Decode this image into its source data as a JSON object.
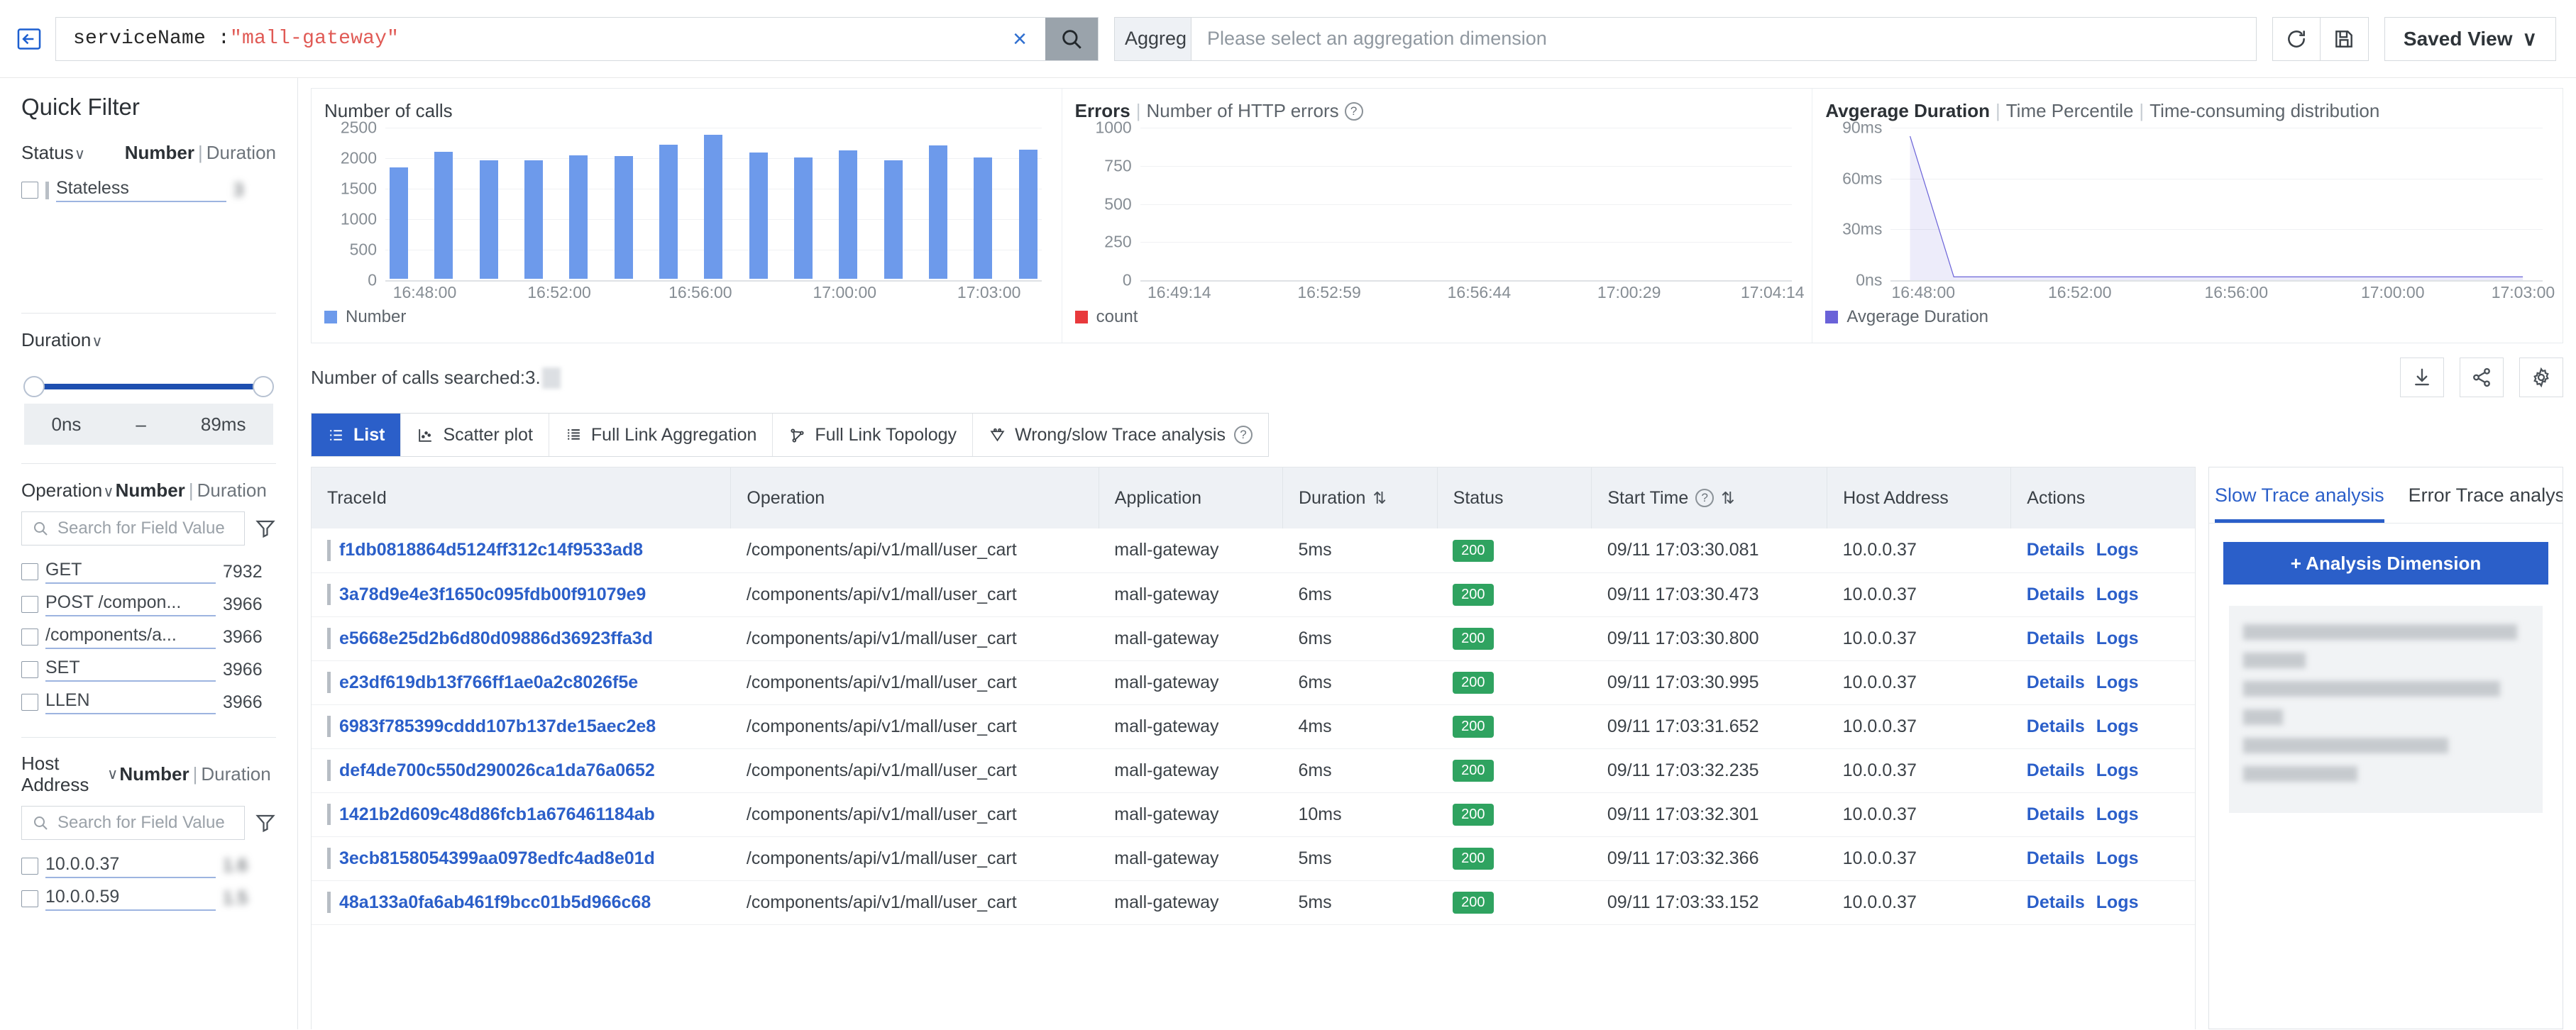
{
  "topbar": {
    "collapse_icon": "collapse-panel-icon",
    "search_key": "serviceName : ",
    "search_value": "\"mall-gateway\"",
    "clear_label": "×",
    "search_icon": "search-icon",
    "agg_label": "Aggreg",
    "agg_placeholder": "Please select an aggregation dimension",
    "refresh_icon": "refresh-icon",
    "save_icon": "save-disk-icon",
    "saved_view_label": "Saved View",
    "saved_view_caret": "∨"
  },
  "sidebar": {
    "title": "Quick Filter",
    "facets": [
      {
        "name": "Status",
        "caret": "∨",
        "metric_number": "Number",
        "metric_sep": "|",
        "metric_duration": "Duration",
        "rows": [
          {
            "label": "Stateless",
            "count": "3",
            "blurred": true
          }
        ]
      },
      {
        "name": "Duration",
        "caret": "∨",
        "slider": {
          "min_label": "0ns",
          "dash": "–",
          "max_label": "89ms"
        }
      },
      {
        "name": "Operation",
        "caret": "∨",
        "metric_number": "Number",
        "metric_sep": "|",
        "metric_duration": "Duration",
        "search_placeholder": "Search for Field Value",
        "rows": [
          {
            "label": "GET",
            "count": "7932"
          },
          {
            "label": "POST /compon...",
            "count": "3966"
          },
          {
            "label": "/components/a...",
            "count": "3966"
          },
          {
            "label": "SET",
            "count": "3966"
          },
          {
            "label": "LLEN",
            "count": "3966"
          }
        ]
      },
      {
        "name": "Host Address",
        "caret": "∨",
        "metric_number": "Number",
        "metric_sep": "|",
        "metric_duration": "Duration",
        "search_placeholder": "Search for Field Value",
        "rows": [
          {
            "label": "10.0.0.37",
            "count": "1.6",
            "blurred": true
          },
          {
            "label": "10.0.0.59",
            "count": "1.5",
            "blurred": true
          }
        ]
      }
    ]
  },
  "chart_data": [
    {
      "type": "bar",
      "title": "Number of calls",
      "xlabel": "",
      "ylabel": "",
      "ylim": [
        0,
        2500
      ],
      "yticks": [
        0,
        500,
        1000,
        1500,
        2000,
        2500
      ],
      "xticks": [
        "16:48:00",
        "16:52:00",
        "16:56:00",
        "17:00:00",
        "17:03:00"
      ],
      "categories": [
        "16:48",
        "16:49",
        "16:50",
        "16:51",
        "16:52",
        "16:53",
        "16:54",
        "16:55",
        "16:56",
        "16:57",
        "16:58",
        "16:59",
        "17:00",
        "17:01",
        "17:02"
      ],
      "values": [
        1840,
        2100,
        1960,
        1960,
        2040,
        2035,
        2215,
        2385,
        2085,
        2010,
        2120,
        1965,
        2210,
        2005,
        2135
      ],
      "legend": [
        "Number"
      ],
      "color": "#6d9aeb",
      "grid": true
    },
    {
      "type": "line",
      "title": "Errors",
      "title_sub": "Number of HTTP errors",
      "ylim": [
        0,
        1000
      ],
      "yticks": [
        0,
        250,
        500,
        750,
        1000
      ],
      "xticks": [
        "16:49:14",
        "16:52:59",
        "16:56:44",
        "17:00:29",
        "17:04:14"
      ],
      "values": [
        0,
        0,
        0,
        0,
        0,
        0,
        0,
        0,
        0,
        0,
        0,
        0,
        0,
        0,
        0
      ],
      "legend": [
        "count"
      ],
      "color": "#e8393c",
      "grid": true
    },
    {
      "type": "area",
      "title": "Avgerage Duration",
      "title_sub2": "Time Percentile",
      "title_sub3": "Time-consuming distribution",
      "ylim": [
        0,
        90
      ],
      "yticks": [
        "0ns",
        "30ms",
        "60ms",
        "90ms"
      ],
      "xticks": [
        "16:48:00",
        "16:52:00",
        "16:56:00",
        "17:00:00",
        "17:03:00"
      ],
      "values": [
        85,
        2,
        2,
        2,
        2,
        2,
        2,
        2,
        2,
        2,
        2,
        2,
        2,
        2,
        2
      ],
      "legend": [
        "Avgerage Duration"
      ],
      "color": "#6a62d8",
      "grid": true
    }
  ],
  "subtoolbar": {
    "searched_label": "Number of calls searched:3.",
    "download_icon": "download-icon",
    "share_icon": "share-icon",
    "settings_icon": "gear-icon"
  },
  "tabs": [
    {
      "label": "List",
      "icon": "list-icon",
      "active": true
    },
    {
      "label": "Scatter plot",
      "icon": "scatter-plot-icon",
      "active": false
    },
    {
      "label": "Full Link Aggregation",
      "icon": "aggregation-icon",
      "active": false
    },
    {
      "label": "Full Link Topology",
      "icon": "topology-icon",
      "active": false
    },
    {
      "label": "Wrong/slow Trace analysis",
      "icon": "trace-analysis-icon",
      "active": false,
      "help": "?"
    }
  ],
  "table": {
    "columns": [
      {
        "label": "TraceId",
        "sort": false,
        "help": false
      },
      {
        "label": "Operation",
        "sort": false,
        "help": false
      },
      {
        "label": "Application",
        "sort": false,
        "help": false
      },
      {
        "label": "Duration",
        "sort": true,
        "help": false
      },
      {
        "label": "Status",
        "sort": false,
        "help": false
      },
      {
        "label": "Start Time",
        "sort": true,
        "help": true
      },
      {
        "label": "Host Address",
        "sort": false,
        "help": false
      },
      {
        "label": "Actions",
        "sort": false,
        "help": false
      }
    ],
    "sort_glyph": "⇅",
    "action_details": "Details",
    "action_logs": "Logs",
    "rows": [
      {
        "trace": "f1db0818864d5124ff312c14f9533ad8",
        "operation": "/components/api/v1/mall/user_cart",
        "application": "mall-gateway",
        "duration": "5ms",
        "status": "200",
        "start": "09/11 17:03:30.081",
        "host": "10.0.0.37"
      },
      {
        "trace": "3a78d9e4e3f1650c095fdb00f91079e9",
        "operation": "/components/api/v1/mall/user_cart",
        "application": "mall-gateway",
        "duration": "6ms",
        "status": "200",
        "start": "09/11 17:03:30.473",
        "host": "10.0.0.37"
      },
      {
        "trace": "e5668e25d2b6d80d09886d36923ffa3d",
        "operation": "/components/api/v1/mall/user_cart",
        "application": "mall-gateway",
        "duration": "6ms",
        "status": "200",
        "start": "09/11 17:03:30.800",
        "host": "10.0.0.37"
      },
      {
        "trace": "e23df619db13f766ff1ae0a2c8026f5e",
        "operation": "/components/api/v1/mall/user_cart",
        "application": "mall-gateway",
        "duration": "6ms",
        "status": "200",
        "start": "09/11 17:03:30.995",
        "host": "10.0.0.37"
      },
      {
        "trace": "6983f785399cddd107b137de15aec2e8",
        "operation": "/components/api/v1/mall/user_cart",
        "application": "mall-gateway",
        "duration": "4ms",
        "status": "200",
        "start": "09/11 17:03:31.652",
        "host": "10.0.0.37"
      },
      {
        "trace": "def4de700c550d290026ca1da76a0652",
        "operation": "/components/api/v1/mall/user_cart",
        "application": "mall-gateway",
        "duration": "6ms",
        "status": "200",
        "start": "09/11 17:03:32.235",
        "host": "10.0.0.37"
      },
      {
        "trace": "1421b2d609c48d86fcb1a676461184ab",
        "operation": "/components/api/v1/mall/user_cart",
        "application": "mall-gateway",
        "duration": "10ms",
        "status": "200",
        "start": "09/11 17:03:32.301",
        "host": "10.0.0.37"
      },
      {
        "trace": "3ecb8158054399aa0978edfc4ad8e01d",
        "operation": "/components/api/v1/mall/user_cart",
        "application": "mall-gateway",
        "duration": "5ms",
        "status": "200",
        "start": "09/11 17:03:32.366",
        "host": "10.0.0.37"
      },
      {
        "trace": "48a133a0fa6ab461f9bcc01b5d966c68",
        "operation": "/components/api/v1/mall/user_cart",
        "application": "mall-gateway",
        "duration": "5ms",
        "status": "200",
        "start": "09/11 17:03:33.152",
        "host": "10.0.0.37"
      }
    ]
  },
  "right_panel": {
    "tabs": [
      {
        "label": "Slow Trace analysis",
        "active": true
      },
      {
        "label": "Error Trace analysis",
        "active": false
      }
    ],
    "analysis_button": "+ Analysis Dimension"
  },
  "colors": {
    "accent": "#2b5fc9",
    "bar": "#6d9aeb",
    "error": "#e8393c",
    "duration": "#6a62d8",
    "status_ok": "#2fa360"
  }
}
